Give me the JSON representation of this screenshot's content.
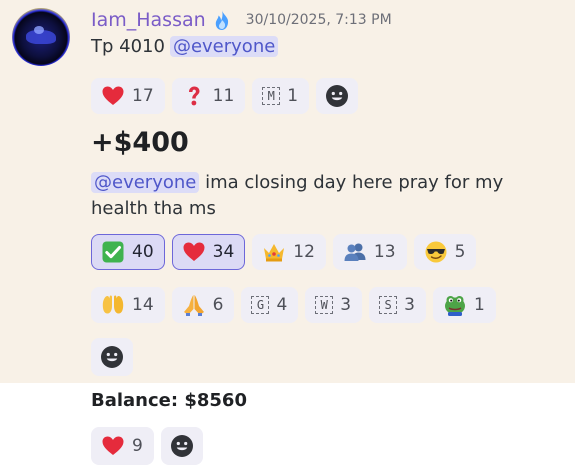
{
  "message": {
    "username": "Iam_Hassan",
    "timestamp": "30/10/2025, 7:13 PM",
    "line1_text": "Tp 4010",
    "mention": "@everyone",
    "reactions1": [
      {
        "emoji": "heart-icon",
        "count": "17"
      },
      {
        "emoji": "question-icon",
        "count": "11"
      },
      {
        "emoji": "M",
        "count": "1"
      }
    ],
    "big_text": "+$400",
    "text2_mention": "@everyone",
    "text2": " ima closing day here pray for my health tha ms",
    "reactions2_row1": [
      {
        "emoji": "check-icon",
        "count": "40",
        "active": true
      },
      {
        "emoji": "heart-icon",
        "count": "34",
        "active": true
      },
      {
        "emoji": "crown-icon",
        "count": "12"
      },
      {
        "emoji": "users-icon",
        "count": "13"
      },
      {
        "emoji": "cool-face-icon",
        "count": "5"
      }
    ],
    "reactions2_row2": [
      {
        "emoji": "raised-hands-icon",
        "count": "14"
      },
      {
        "emoji": "praying-hands-icon",
        "count": "6"
      },
      {
        "emoji": "G",
        "count": "4"
      },
      {
        "emoji": "W",
        "count": "3"
      },
      {
        "emoji": "S",
        "count": "3"
      },
      {
        "emoji": "frog-icon",
        "count": "1"
      }
    ]
  },
  "balance": {
    "text": "Balance: $8560",
    "reactions": [
      {
        "emoji": "heart-icon",
        "count": "9"
      }
    ]
  },
  "colors": {
    "highlight_bg": "#f8f1e7",
    "username": "#7a5cc7",
    "mention_bg": "#dcdcf7",
    "mention_text": "#4f57c9",
    "active_reaction_border": "#6d67d9"
  }
}
